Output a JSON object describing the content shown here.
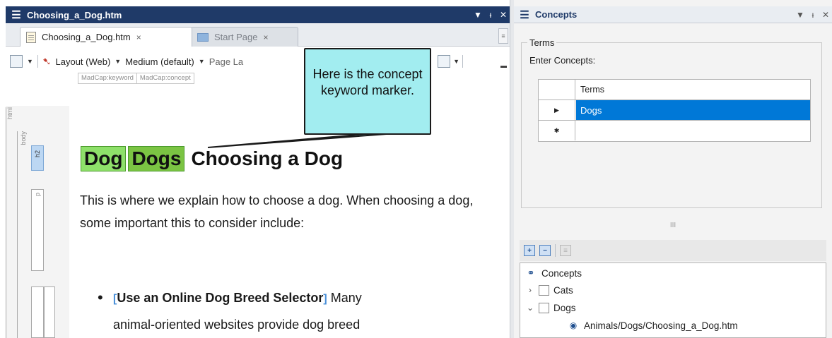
{
  "editor": {
    "window_title": "Choosing_a_Dog.htm",
    "tabs": [
      {
        "label": "Choosing_a_Dog.htm",
        "close": "×"
      },
      {
        "label": "Start Page",
        "close": "×"
      }
    ],
    "toolbar": {
      "layout_label": "Layout (Web)",
      "medium_label": "Medium (default)",
      "page_layout_label": "Page La"
    },
    "tag_strip": [
      "MadCap:keyword",
      "MadCap:concept"
    ],
    "gutter_labels": {
      "html": "html",
      "body": "body",
      "h2": "h2",
      "p": "p"
    },
    "heading": {
      "keyword1": "Dog",
      "keyword2": "Dogs",
      "text": "Choosing a Dog"
    },
    "paragraph": "This is where we explain how to choose a dog. When choosing a dog, some important this to consider include:",
    "bullet": {
      "bold": "Use an Online Dog Breed Selector",
      "rest_line1": " Many",
      "line2": "animal-oriented websites provide dog breed"
    },
    "callout": "Here is the concept keyword marker."
  },
  "concepts_pane": {
    "window_title": "Concepts",
    "group_title": "Terms",
    "enter_label": "Enter Concepts:",
    "grid": {
      "header": "Terms",
      "rows": [
        {
          "marker": "▶",
          "value": "Dogs",
          "selected": true
        },
        {
          "marker": "✱",
          "value": "",
          "selected": false
        }
      ]
    },
    "splitter_grip": "III",
    "tree": {
      "root": "Concepts",
      "items": [
        {
          "label": "Cats",
          "expanded": false
        },
        {
          "label": "Dogs",
          "expanded": true
        }
      ],
      "child": "Animals/Dogs/Choosing_a_Dog.htm"
    }
  },
  "colors": {
    "title_bar": "#1f3a68",
    "keyword_light": "#8ee06a",
    "keyword_dark": "#7bc443",
    "callout_fill": "#a2edf0",
    "selection": "#0078d7"
  }
}
